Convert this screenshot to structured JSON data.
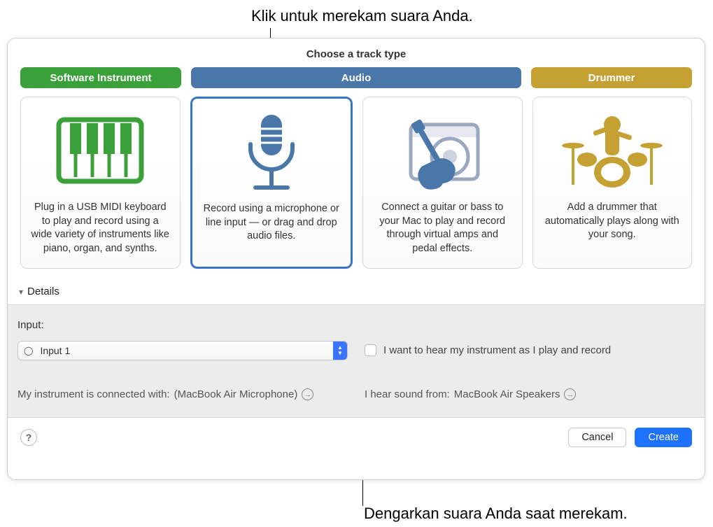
{
  "callout_top": "Klik untuk merekam suara Anda.",
  "callout_bottom": "Dengarkan suara Anda saat merekam.",
  "dialog": {
    "title": "Choose a track type",
    "tabs": {
      "software": "Software Instrument",
      "audio": "Audio",
      "drummer": "Drummer"
    },
    "cards": {
      "software": "Plug in a USB MIDI keyboard to play and record using a wide variety of instruments like piano, organ, and synths.",
      "mic": "Record using a microphone or line input — or drag and drop audio files.",
      "guitar": "Connect a guitar or bass to your Mac to play and record through virtual amps and pedal effects.",
      "drummer": "Add a drummer that automatically plays along with your song."
    },
    "details_label": "Details",
    "details": {
      "input_label": "Input:",
      "input_value": "Input 1",
      "monitor_label": "I want to hear my instrument as I play and record",
      "connected_label": "My instrument is connected with:",
      "connected_value": "(MacBook Air Microphone)",
      "output_label": "I hear sound from:",
      "output_value": "MacBook Air Speakers"
    },
    "buttons": {
      "cancel": "Cancel",
      "create": "Create"
    }
  }
}
